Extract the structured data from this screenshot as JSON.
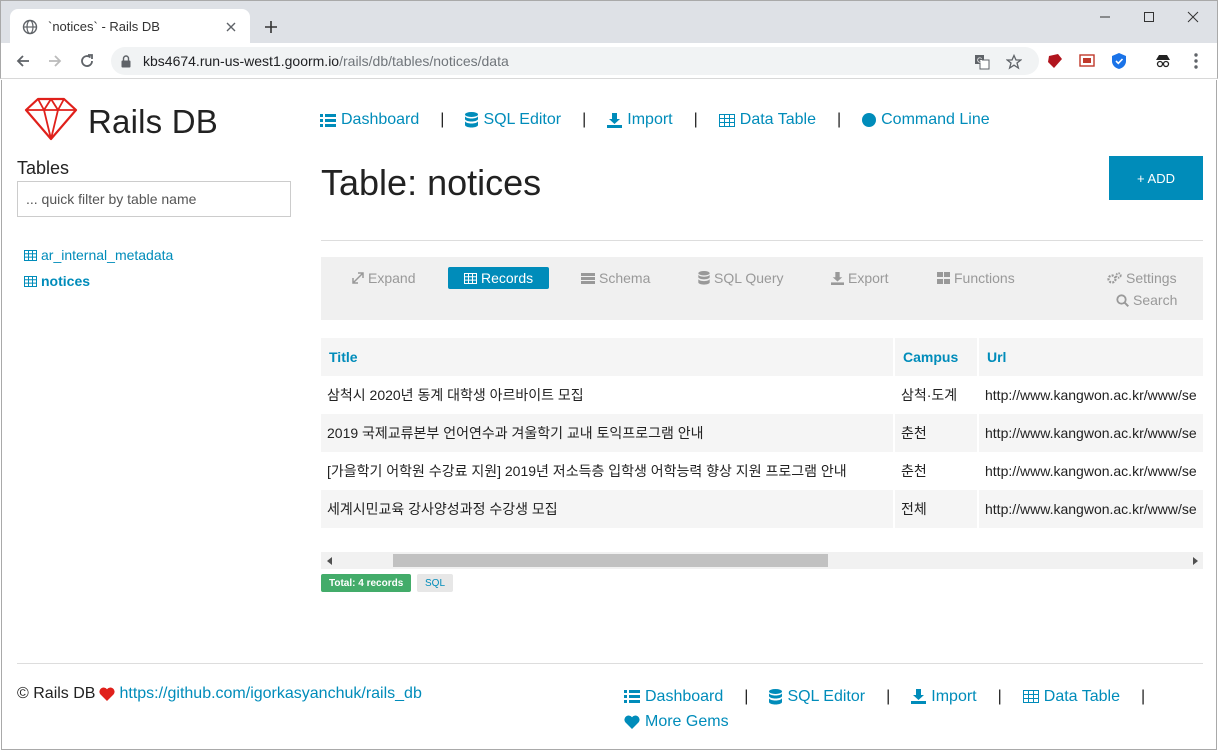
{
  "browser": {
    "tab_title": "`notices` - Rails DB",
    "url_host": "kbs4674.run-us-west1.goorm.io",
    "url_path": "/rails/db/tables/notices/data"
  },
  "app": {
    "logo_text": "Rails DB",
    "brand_color": "#008cba"
  },
  "sidebar": {
    "title": "Tables",
    "filter_placeholder": "... quick filter by table name",
    "tables": [
      {
        "label": "ar_internal_metadata",
        "active": false
      },
      {
        "label": "notices",
        "active": true
      }
    ]
  },
  "nav": {
    "dashboard": "Dashboard",
    "sql_editor": "SQL Editor",
    "import": "Import",
    "data_table": "Data Table",
    "command_line": "Command Line",
    "separator": "|"
  },
  "main": {
    "title": "Table: notices",
    "add_label": "+ ADD",
    "tabs": {
      "expand": "Expand",
      "records": "Records",
      "schema": "Schema",
      "sql_query": "SQL Query",
      "export": "Export",
      "functions": "Functions",
      "settings": "Settings",
      "search": "Search"
    },
    "columns": {
      "title": "Title",
      "campus": "Campus",
      "url": "Url"
    },
    "rows": [
      {
        "title": "삼척시 2020년 동계 대학생 아르바이트 모집",
        "campus": "삼척·도계",
        "url": "http://www.kangwon.ac.kr/www/se"
      },
      {
        "title": "2019 국제교류본부 언어연수과 겨울학기 교내 토익프로그램 안내",
        "campus": "춘천",
        "url": "http://www.kangwon.ac.kr/www/se"
      },
      {
        "title": "[가을학기 어학원 수강료 지원] 2019년 저소득층 입학생 어학능력 향상 지원 프로그램 안내",
        "campus": "춘천",
        "url": "http://www.kangwon.ac.kr/www/se"
      },
      {
        "title": "세계시민교육 강사양성과정 수강생 모집",
        "campus": "전체",
        "url": "http://www.kangwon.ac.kr/www/se"
      }
    ],
    "total_badge": "Total: 4 records",
    "sql_badge": "SQL"
  },
  "footer": {
    "copyright": "© Rails DB",
    "github_link": "https://github.com/igorkasyanchuk/rails_db",
    "dashboard": "Dashboard",
    "sql_editor": "SQL Editor",
    "import": "Import",
    "data_table": "Data Table",
    "more_gems": "More Gems"
  }
}
